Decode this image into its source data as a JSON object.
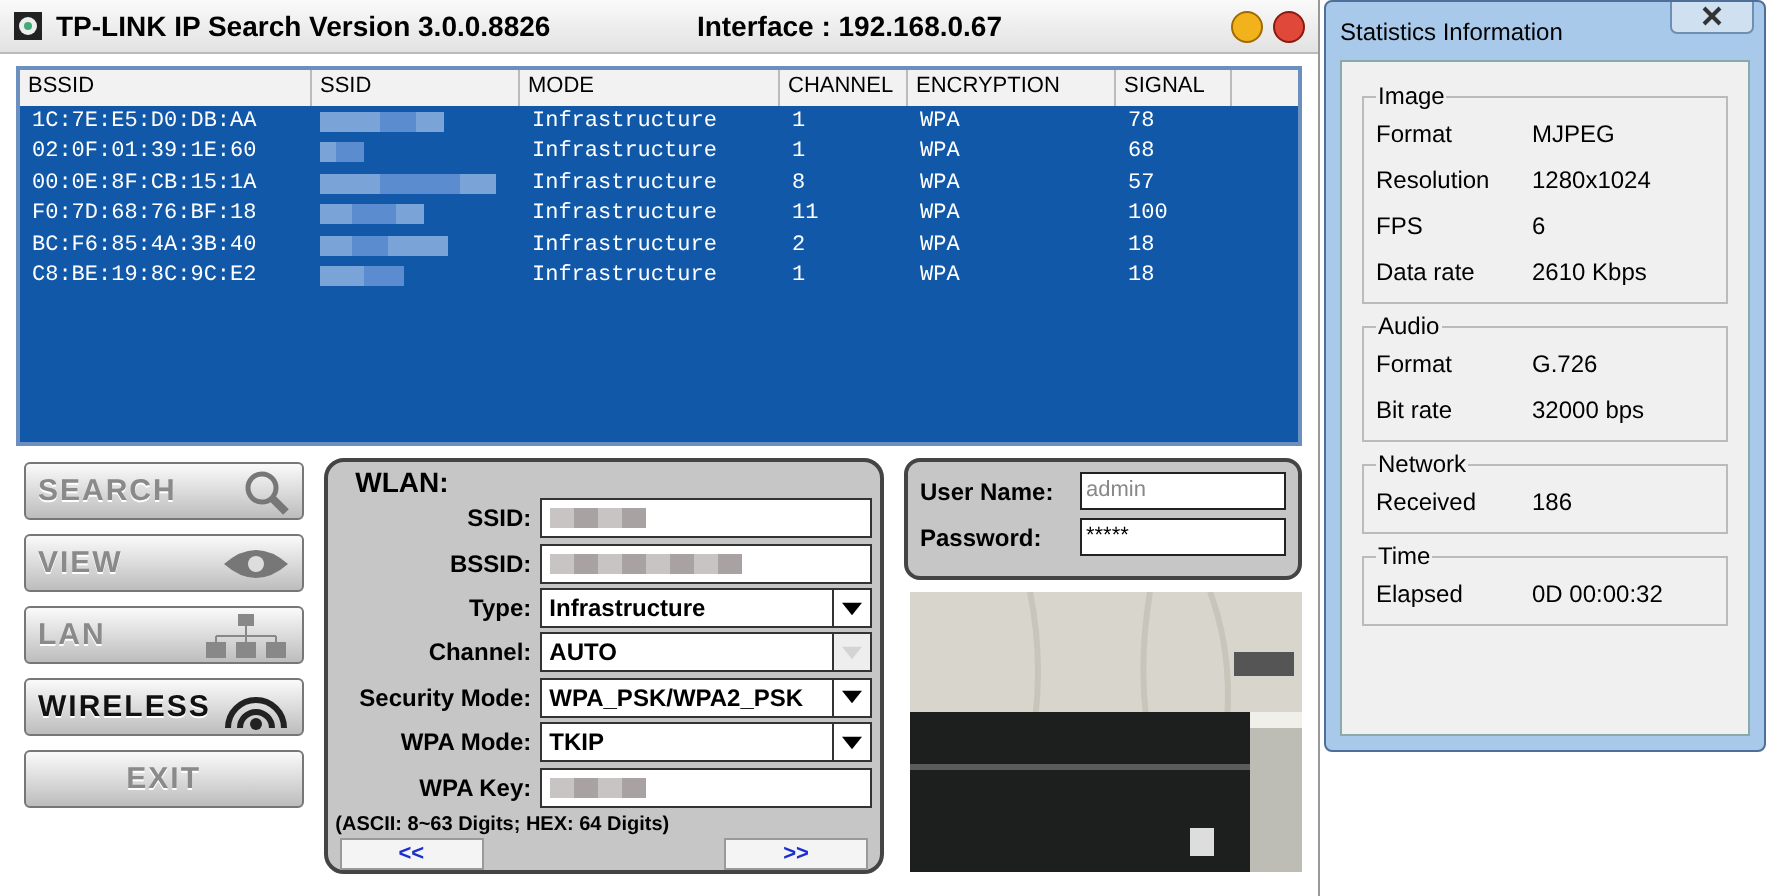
{
  "window": {
    "title": "TP-LINK IP Search Version 3.0.0.8826",
    "interface": "Interface : 192.168.0.67"
  },
  "table": {
    "columns": [
      "BSSID",
      "SSID",
      "MODE",
      "CHANNEL",
      "ENCRYPTION",
      "SIGNAL"
    ],
    "rows": [
      {
        "bssid": "1C:7E:E5:D0:DB:AA",
        "mode": "Infrastructure",
        "channel": "1",
        "encryption": "WPA",
        "signal": "78"
      },
      {
        "bssid": "02:0F:01:39:1E:60",
        "mode": "Infrastructure",
        "channel": "1",
        "encryption": "WPA",
        "signal": "68"
      },
      {
        "bssid": "00:0E:8F:CB:15:1A",
        "mode": "Infrastructure",
        "channel": "8",
        "encryption": "WPA",
        "signal": "57"
      },
      {
        "bssid": "F0:7D:68:76:BF:18",
        "mode": "Infrastructure",
        "channel": "11",
        "encryption": "WPA",
        "signal": "100"
      },
      {
        "bssid": "BC:F6:85:4A:3B:40",
        "mode": "Infrastructure",
        "channel": "2",
        "encryption": "WPA",
        "signal": "18"
      },
      {
        "bssid": "C8:BE:19:8C:9C:E2",
        "mode": "Infrastructure",
        "channel": "1",
        "encryption": "WPA",
        "signal": "18"
      }
    ]
  },
  "nav": [
    {
      "label": "SEARCH",
      "selected": false
    },
    {
      "label": "VIEW",
      "selected": false
    },
    {
      "label": "LAN",
      "selected": false
    },
    {
      "label": "WIRELESS",
      "selected": true
    },
    {
      "label": "EXIT",
      "selected": false
    }
  ],
  "wlan": {
    "title": "WLAN:",
    "fields": [
      {
        "label": "SSID:",
        "kind": "blurred"
      },
      {
        "label": "BSSID:",
        "kind": "blurred"
      },
      {
        "label": "Type:",
        "kind": "select",
        "value": "Infrastructure",
        "disabled": false
      },
      {
        "label": "Channel:",
        "kind": "select",
        "value": "AUTO",
        "disabled": true
      },
      {
        "label": "Security Mode:",
        "kind": "select",
        "value": "WPA_PSK/WPA2_PSK",
        "disabled": false
      },
      {
        "label": "WPA Mode:",
        "kind": "select",
        "value": "TKIP",
        "disabled": false
      },
      {
        "label": "WPA Key:",
        "kind": "blurred"
      }
    ],
    "hint": "(ASCII: 8~63 Digits; HEX: 64 Digits)",
    "prev": "<<",
    "next": ">>"
  },
  "login": {
    "user_label": "User Name:",
    "user_value": "admin",
    "pass_label": "Password:",
    "pass_value": "*****"
  },
  "stats": {
    "title": "Statistics Information",
    "groups": [
      {
        "title": "Image",
        "rows": [
          [
            "Format",
            "MJPEG"
          ],
          [
            "Resolution",
            "1280x1024"
          ],
          [
            "FPS",
            "6"
          ],
          [
            "Data rate",
            "2610 Kbps"
          ]
        ]
      },
      {
        "title": "Audio",
        "rows": [
          [
            "Format",
            "G.726"
          ],
          [
            "Bit rate",
            "32000 bps"
          ]
        ]
      },
      {
        "title": "Network",
        "rows": [
          [
            "Received",
            "186"
          ]
        ]
      },
      {
        "title": "Time",
        "rows": [
          [
            "Elapsed",
            "0D 00:00:32"
          ]
        ]
      }
    ]
  }
}
